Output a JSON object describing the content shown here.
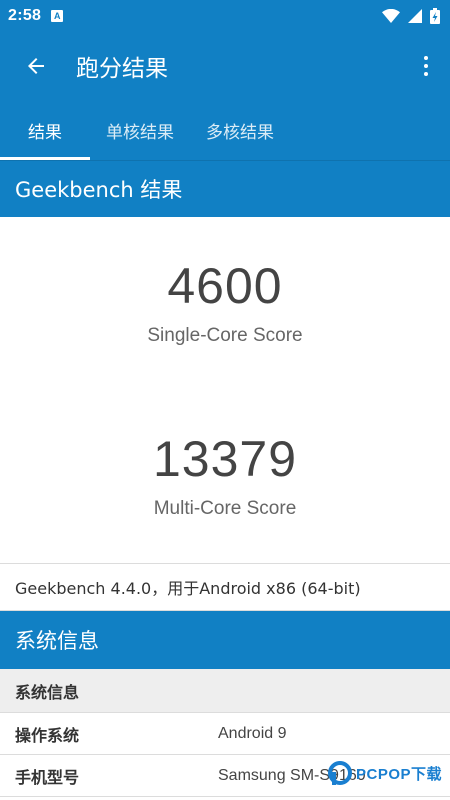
{
  "status_bar": {
    "time": "2:58",
    "notification_letter": "A"
  },
  "app_bar": {
    "title": "跑分结果",
    "back_icon": "arrow-back-icon",
    "menu_icon": "more-vert-icon"
  },
  "tabs": [
    {
      "label": "结果",
      "active": true
    },
    {
      "label": "单核结果",
      "active": false
    },
    {
      "label": "多核结果",
      "active": false
    }
  ],
  "geekbench_section": {
    "title": "Geekbench 结果"
  },
  "scores": {
    "single_value": "4600",
    "single_label": "Single-Core Score",
    "multi_value": "13379",
    "multi_label": "Multi-Core Score"
  },
  "version_text": "Geekbench 4.4.0，用于Android x86 (64-bit)",
  "system_section": {
    "title": "系统信息",
    "subheader": "系统信息",
    "rows": [
      {
        "key": "操作系统",
        "value": "Android 9"
      },
      {
        "key": "手机型号",
        "value": "Samsung SM-S9160"
      }
    ]
  },
  "watermark": {
    "text": "PCPOP下载"
  },
  "colors": {
    "primary": "#1180c4",
    "watermark": "#1a7fd0"
  }
}
